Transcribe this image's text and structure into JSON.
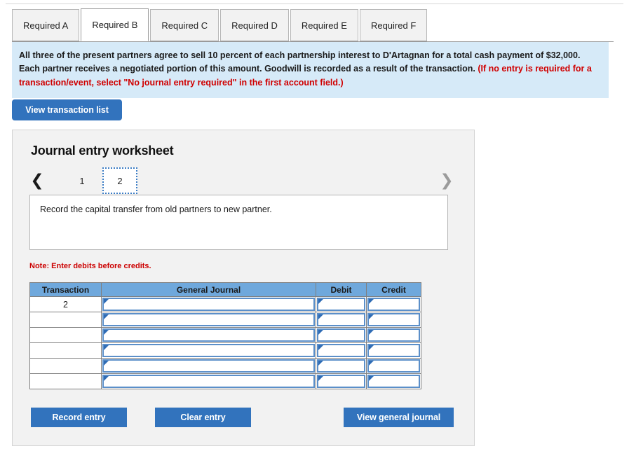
{
  "tabs": [
    {
      "label": "Required A",
      "active": false
    },
    {
      "label": "Required B",
      "active": true
    },
    {
      "label": "Required C",
      "active": false
    },
    {
      "label": "Required D",
      "active": false
    },
    {
      "label": "Required E",
      "active": false
    },
    {
      "label": "Required F",
      "active": false
    }
  ],
  "info": {
    "body": "All three of the present partners agree to sell 10 percent of each partnership interest to D'Artagnan for a total cash payment of $32,000. Each partner receives a negotiated portion of this amount. Goodwill is recorded as a result of the transaction. ",
    "hint": "(If no entry is required for a transaction/event, select \"No journal entry required\" in the first account field.)"
  },
  "buttons": {
    "view_transaction_list": "View transaction list",
    "record_entry": "Record entry",
    "clear_entry": "Clear entry",
    "view_general_journal": "View general journal"
  },
  "worksheet": {
    "title": "Journal entry worksheet",
    "pager": {
      "prev_icon": "chevron-left",
      "next_icon": "chevron-right",
      "pages": [
        "1",
        "2"
      ],
      "active_page": "2"
    },
    "description": "Record the capital transfer from old partners to new partner.",
    "note": "Note: Enter debits before credits.",
    "table": {
      "headers": [
        "Transaction",
        "General Journal",
        "Debit",
        "Credit"
      ],
      "rows": [
        {
          "transaction": "2",
          "general_journal": "",
          "debit": "",
          "credit": ""
        },
        {
          "transaction": "",
          "general_journal": "",
          "debit": "",
          "credit": ""
        },
        {
          "transaction": "",
          "general_journal": "",
          "debit": "",
          "credit": ""
        },
        {
          "transaction": "",
          "general_journal": "",
          "debit": "",
          "credit": ""
        },
        {
          "transaction": "",
          "general_journal": "",
          "debit": "",
          "credit": ""
        },
        {
          "transaction": "",
          "general_journal": "",
          "debit": "",
          "credit": ""
        }
      ]
    }
  },
  "colors": {
    "primary_button": "#3273bd",
    "table_header": "#6fa8dc",
    "info_background": "#d6eaf8",
    "alert_text": "#cc0000",
    "field_border": "#5b8fc9"
  }
}
